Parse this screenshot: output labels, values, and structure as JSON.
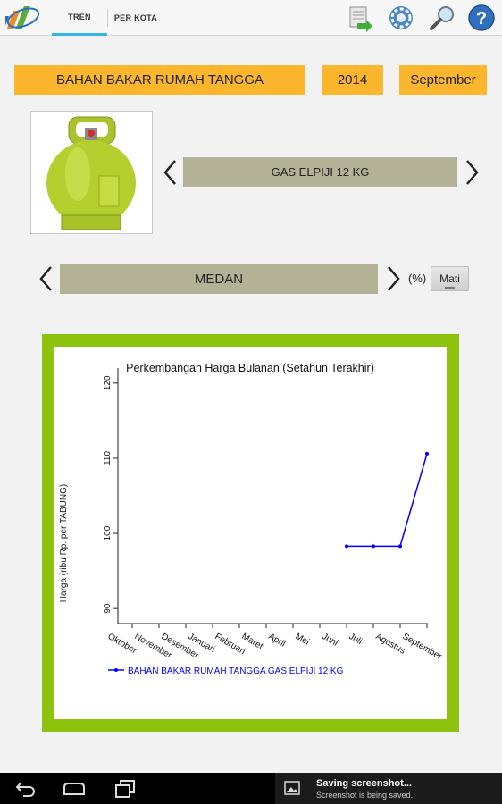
{
  "tabs": [
    {
      "label": "TREN",
      "active": true
    },
    {
      "label": "PER KOTA",
      "active": false
    }
  ],
  "actions": [
    "export-icon",
    "settings-icon",
    "search-icon",
    "help-icon"
  ],
  "header": {
    "commodity_group": "BAHAN BAKAR RUMAH TANGGA",
    "year": "2014",
    "month": "September"
  },
  "commodity_selector": {
    "value": "GAS ELPIJI 12 KG"
  },
  "city_selector": {
    "value": "MEDAN"
  },
  "percent_label": "(%)",
  "toggle_label": "Mati",
  "colors": {
    "accent": "#fbb62d",
    "selector": "#b3b296",
    "frame": "#8dc20f",
    "line": "#0000ff",
    "tab_indicator": "#33b5e5"
  },
  "chart_data": {
    "type": "line",
    "title": "Perkembangan Harga Bulanan (Setahun Terakhir)",
    "xlabel": "",
    "ylabel": "Harga (ribu Rp. per TABUNG)",
    "categories": [
      "Oktober",
      "November",
      "Desember",
      "Januari",
      "Februari",
      "Maret",
      "April",
      "Mei",
      "Juni",
      "Juli",
      "Agustus",
      "September"
    ],
    "ylim": [
      88,
      122
    ],
    "yticks": [
      90,
      100,
      110,
      120
    ],
    "series": [
      {
        "name": "BAHAN BAKAR RUMAH TANGGA GAS ELPIJI 12 KG",
        "values": [
          null,
          null,
          null,
          null,
          null,
          null,
          null,
          null,
          98.3,
          98.3,
          98.3,
          110.6
        ]
      }
    ],
    "legend": "bottom-left",
    "grid": false
  },
  "notification": {
    "title": "Saving screenshot...",
    "subtitle": "Screenshot is being saved."
  }
}
